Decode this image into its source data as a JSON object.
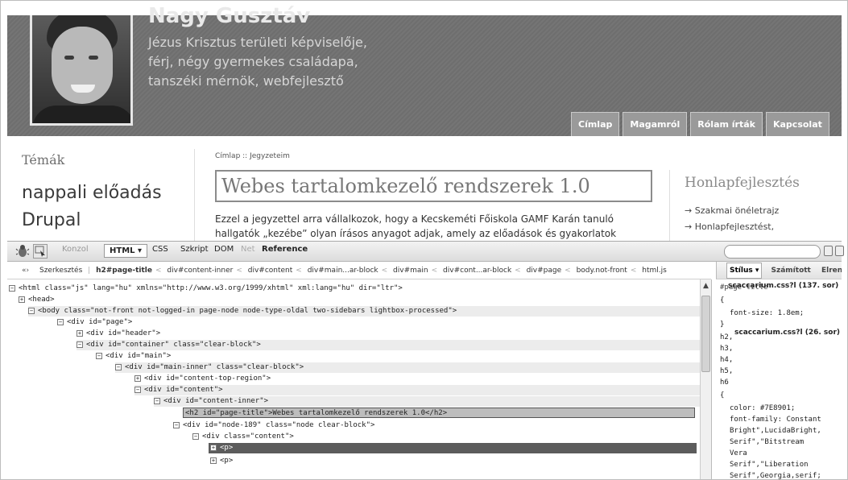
{
  "site": {
    "name": "Nagy Gusztáv",
    "subtitle_lines": [
      "Jézus Krisztus területi képviselője,",
      "férj, négy gyermekes családapa,",
      "tanszéki mérnök, webfejlesztő"
    ],
    "nav_tabs": [
      "Címlap",
      "Magamról",
      "Rólam írták",
      "Kapcsolat"
    ]
  },
  "sidebar": {
    "title": "Témák",
    "links": [
      "nappali előadás",
      "Drupal"
    ]
  },
  "main": {
    "breadcrumb": "Címlap :: Jegyzeteim",
    "title": "Webes tartalomkezelő rendszerek 1.0",
    "body_lines": [
      "Ezzel a jegyzettel arra vállalkozok, hogy a Kecskeméti Főiskola GAMF Karán tanuló",
      "hallgatók „kezébe” olyan írásos anyagot adjak, amely az előadások és gyakorlatok"
    ]
  },
  "right_sidebar": {
    "title": "Honlapfejlesztés",
    "links": [
      "Szakmai önéletrajz",
      "Honlapfejlesztést,"
    ]
  },
  "firebug": {
    "toolbar": {
      "tabs": [
        "Konzol",
        "HTML ▾",
        "CSS",
        "Szkript",
        "DOM",
        "Net",
        "Reference"
      ]
    },
    "path": {
      "edit_label": "Szerkesztés",
      "crumbs": [
        "h2#page-title",
        "div#content-inner",
        "div#content",
        "div#main...ar-block",
        "div#main",
        "div#cont...ar-block",
        "div#page",
        "body.not-front",
        "html.js"
      ]
    },
    "side_tabs": [
      "Stílus ▾",
      "Számított",
      "Elren"
    ],
    "tree": [
      "<html class=\"js\" lang=\"hu\" xmlns=\"http://www.w3.org/1999/xhtml\" xml:lang=\"hu\" dir=\"ltr\">",
      "<head>",
      "<body class=\"not-front not-logged-in page-node node-type-oldal two-sidebars lightbox-processed\">",
      "<div id=\"page\">",
      "<div id=\"header\">",
      "<div id=\"container\" class=\"clear-block\">",
      "<div id=\"main\">",
      "<div id=\"main-inner\" class=\"clear-block\">",
      "<div id=\"content-top-region\">",
      "<div id=\"content\">",
      "<div id=\"content-inner\">",
      "<h2 id=\"page-title\">Webes tartalomkezelő rendszerek 1.0</h2>",
      "<div id=\"node-189\" class=\"node clear-block\">",
      "<div class=\"content\">",
      "<p>",
      "<p>"
    ],
    "style": {
      "rule1_selector": "#page-title",
      "rule1_source": "scaccarium.css?l (137. sor)",
      "rule1_open": "{",
      "rule1_decl": "font-size: 1.8em;",
      "rule1_close": "}",
      "rule2_selectors": [
        "h2,",
        "h3,",
        "h4,",
        "h5,",
        "h6"
      ],
      "rule2_source": "scaccarium.css?l (26. sor)",
      "rule2_open": "{",
      "rule2_decls": [
        "color: #7E8901;",
        "font-family: Constant",
        "Bright\",LucidaBright,",
        "Serif\",\"Bitstream",
        "Vera",
        "Serif\",\"Liberation",
        "Serif\",Georgia,serif;"
      ]
    }
  },
  "colors": {
    "header_bg": "#707070",
    "tab_bg": "#9a9a9a",
    "selected_row": "#5c5c5c"
  }
}
